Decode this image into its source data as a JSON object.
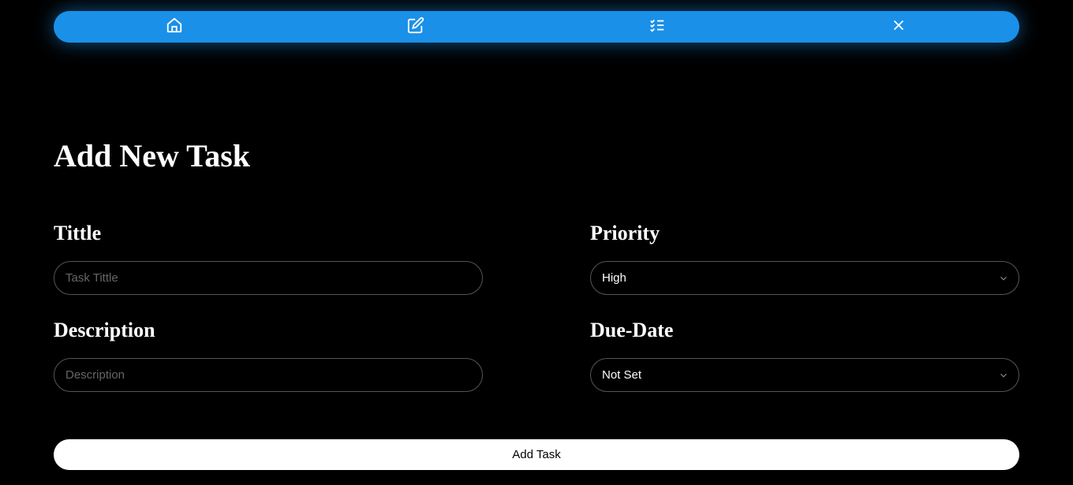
{
  "nav": {
    "items": [
      {
        "icon": "home"
      },
      {
        "icon": "edit"
      },
      {
        "icon": "checklist"
      },
      {
        "icon": "close"
      }
    ]
  },
  "page": {
    "title": "Add New Task"
  },
  "form": {
    "title": {
      "label": "Tittle",
      "placeholder": "Task Tittle",
      "value": ""
    },
    "priority": {
      "label": "Priority",
      "selected": "High",
      "options": [
        "High"
      ]
    },
    "description": {
      "label": "Description",
      "placeholder": "Description",
      "value": ""
    },
    "dueDate": {
      "label": "Due-Date",
      "selected": "Not Set",
      "options": [
        "Not Set"
      ]
    },
    "submitLabel": "Add Task"
  }
}
